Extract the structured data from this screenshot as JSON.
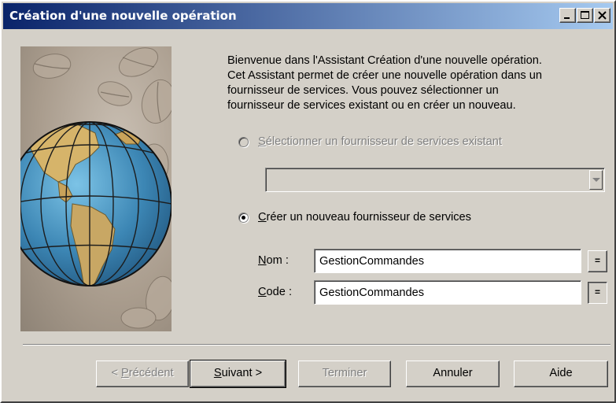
{
  "window": {
    "title": "Création d'une nouvelle opération",
    "controls": {
      "minimize": "minimize-icon",
      "maximize": "maximize-icon",
      "close": "close-icon"
    }
  },
  "intro_text": "Bienvenue dans l'Assistant Création d'une nouvelle opération.\nCet Assistant permet de créer une nouvelle opération dans un\nfournisseur de services. Vous pouvez sélectionner un\nfournisseur de services existant ou en créer un nouveau.",
  "options": {
    "existing": {
      "mnemonic": "S",
      "rest": "électionner un fournisseur de services existant",
      "enabled": false,
      "selected": false
    },
    "existing_select_value": "",
    "create_new": {
      "mnemonic": "C",
      "rest": "réer un nouveau fournisseur de services",
      "enabled": true,
      "selected": true
    }
  },
  "fields": {
    "name": {
      "mnemonic": "N",
      "rest": "om :",
      "value": "GestionCommandes",
      "eq_label": "="
    },
    "code": {
      "mnemonic": "C",
      "rest": "ode :",
      "value": "GestionCommandes",
      "eq_label": "="
    }
  },
  "buttons": {
    "previous": {
      "prefix": "< ",
      "mnemonic": "P",
      "rest": "récédent",
      "enabled": false
    },
    "next": {
      "mnemonic": "S",
      "rest": "uivant >",
      "enabled": true
    },
    "finish": {
      "label": "Terminer",
      "enabled": false
    },
    "cancel": {
      "label": "Annuler",
      "enabled": true
    },
    "help": {
      "label": "Aide",
      "enabled": true
    }
  },
  "colors": {
    "title_bar_start": "#0a246a",
    "title_bar_end": "#a6caf0",
    "face": "#d4d0c8",
    "globe_ocean": "#3c86b4",
    "globe_land": "#d6b46a"
  }
}
